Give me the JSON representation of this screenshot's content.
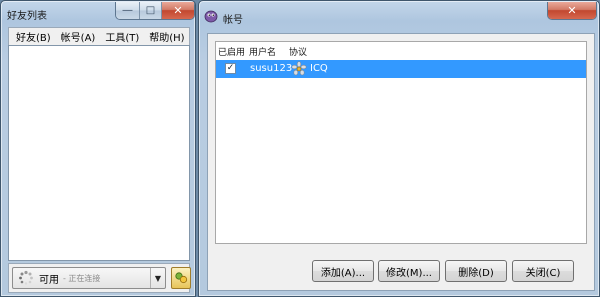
{
  "buddy_window": {
    "title": "好友列表",
    "menu": [
      {
        "label": "好友(B)"
      },
      {
        "label": "帐号(A)"
      },
      {
        "label": "工具(T)"
      },
      {
        "label": "帮助(H)"
      }
    ],
    "status": {
      "label": "可用",
      "sublabel": "- 正在连接"
    }
  },
  "accounts_window": {
    "title": "帐号",
    "columns": {
      "enabled": "已启用",
      "username": "用户名",
      "protocol": "协议"
    },
    "rows": [
      {
        "enabled": true,
        "username": "susu123",
        "protocol": "ICQ"
      }
    ],
    "buttons": {
      "add": "添加(A)...",
      "modify": "修改(M)...",
      "delete": "删除(D)",
      "close": "关闭(C)"
    }
  },
  "icons": {
    "window_min": "minimize-icon",
    "window_max": "maximize-icon",
    "window_close": "close-icon",
    "app": "pidgin-icon",
    "protocol": "icq-flower-icon",
    "status_spinner": "connecting-spinner-icon",
    "buddy": "buddy-icon"
  },
  "colors": {
    "selection": "#3399ff",
    "close_button": "#c2472f"
  }
}
